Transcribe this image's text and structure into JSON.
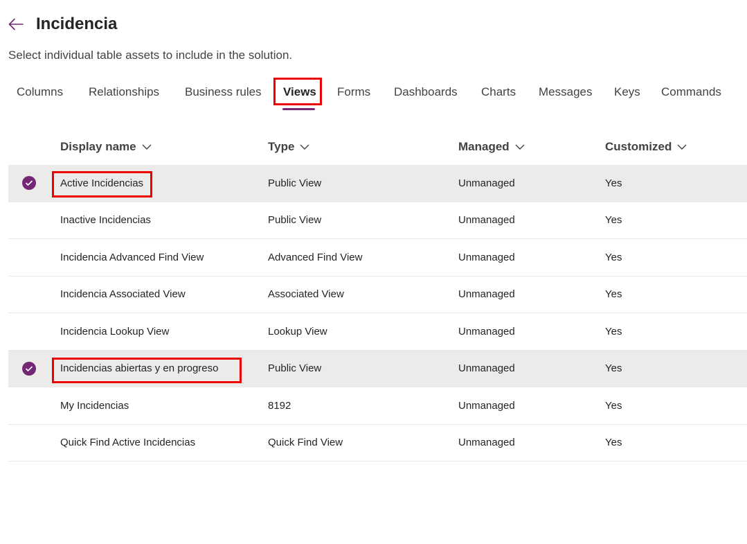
{
  "header": {
    "title": "Incidencia",
    "back_icon": "back-arrow-icon"
  },
  "subtitle": "Select individual table assets to include in the solution.",
  "tabs": [
    {
      "label": "Columns"
    },
    {
      "label": "Relationships"
    },
    {
      "label": "Business rules"
    },
    {
      "label": "Views",
      "active": true
    },
    {
      "label": "Forms"
    },
    {
      "label": "Dashboards"
    },
    {
      "label": "Charts"
    },
    {
      "label": "Messages"
    },
    {
      "label": "Keys"
    },
    {
      "label": "Commands"
    }
  ],
  "grid": {
    "columns": [
      "Display name",
      "Type",
      "Managed",
      "Customized"
    ],
    "rows": [
      {
        "name": "Active Incidencias",
        "type": "Public View",
        "managed": "Unmanaged",
        "customized": "Yes",
        "selected": true
      },
      {
        "name": "Inactive Incidencias",
        "type": "Public View",
        "managed": "Unmanaged",
        "customized": "Yes",
        "selected": false
      },
      {
        "name": "Incidencia Advanced Find View",
        "type": "Advanced Find View",
        "managed": "Unmanaged",
        "customized": "Yes",
        "selected": false
      },
      {
        "name": "Incidencia Associated View",
        "type": "Associated View",
        "managed": "Unmanaged",
        "customized": "Yes",
        "selected": false
      },
      {
        "name": "Incidencia Lookup View",
        "type": "Lookup View",
        "managed": "Unmanaged",
        "customized": "Yes",
        "selected": false
      },
      {
        "name": "Incidencias abiertas y en progreso",
        "type": "Public View",
        "managed": "Unmanaged",
        "customized": "Yes",
        "selected": true
      },
      {
        "name": "My Incidencias",
        "type": "8192",
        "managed": "Unmanaged",
        "customized": "Yes",
        "selected": false
      },
      {
        "name": "Quick Find Active Incidencias",
        "type": "Quick Find View",
        "managed": "Unmanaged",
        "customized": "Yes",
        "selected": false
      }
    ]
  },
  "colors": {
    "accent": "#742774",
    "highlight": "#ee0000",
    "selected_row": "#edebe9"
  }
}
